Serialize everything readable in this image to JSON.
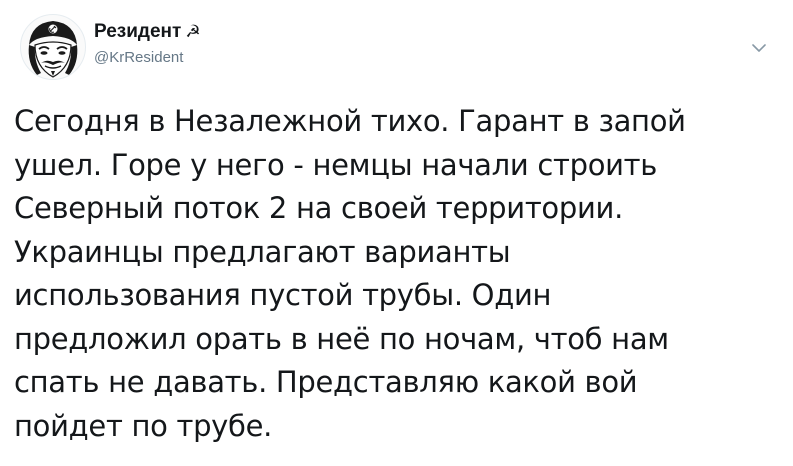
{
  "author": {
    "display_name": "Резидент",
    "name_symbol": "☭",
    "handle": "@KrResident",
    "avatar_icon": "guy-fawkes-mask-icon"
  },
  "menu": {
    "caret_icon": "chevron-down-icon"
  },
  "tweet": {
    "lines": [
      "Сегодня в Незалежной тихо. Гарант в запой",
      "ушел. Горе у него - немцы начали строить",
      "Северный поток 2 на своей территории.",
      "Украинцы предлагают варианты",
      "использования пустой трубы. Один",
      "предложил орать в неё по ночам, чтоб нам",
      "спать не давать. Представляю какой вой",
      "пойдет по трубе."
    ]
  },
  "colors": {
    "text": "#14171a",
    "secondary": "#657786",
    "caret": "#8899a6"
  }
}
